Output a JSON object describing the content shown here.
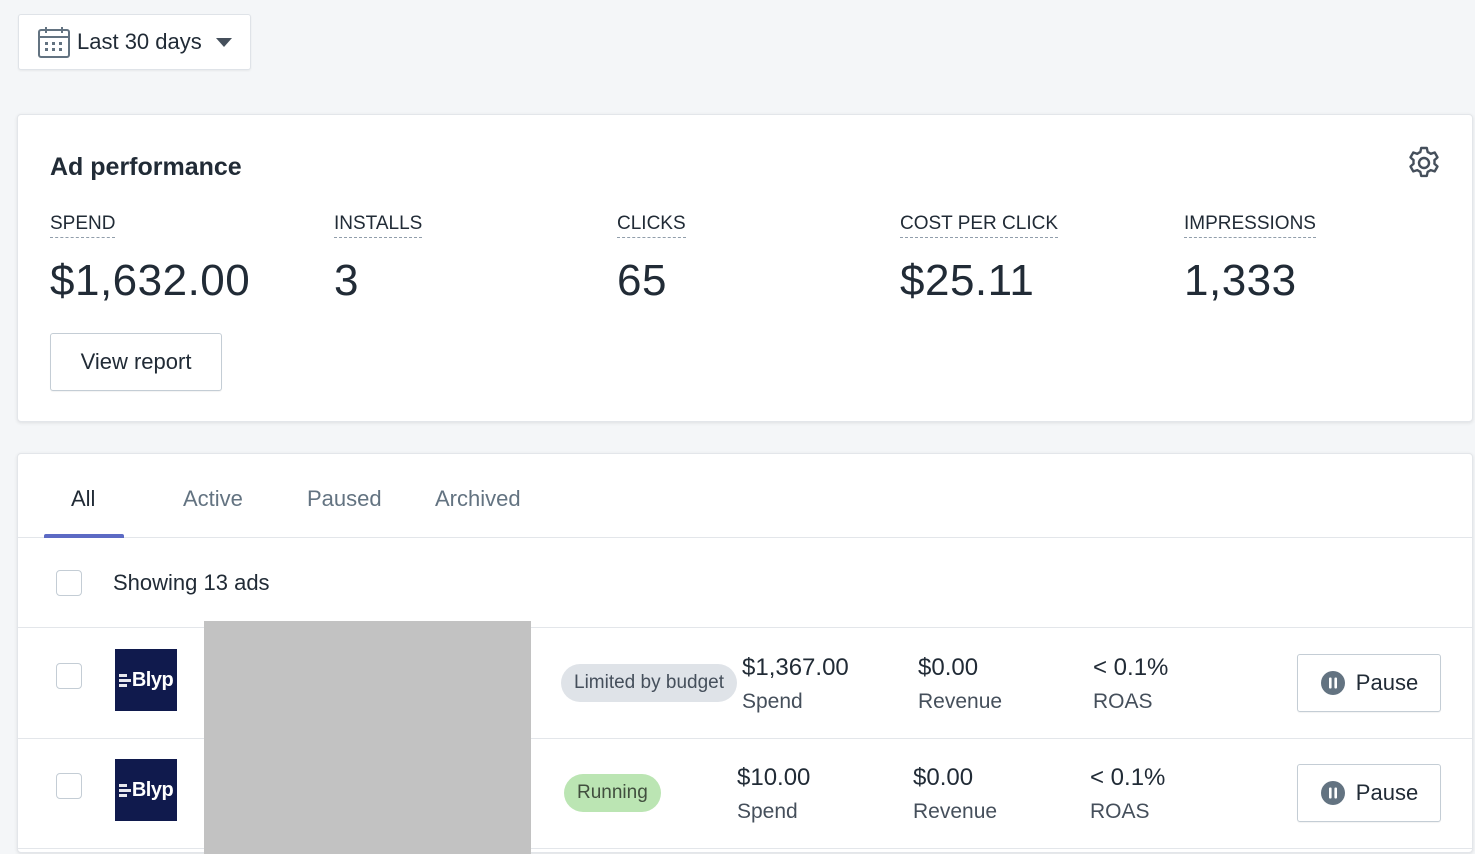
{
  "date_range": {
    "label": "Last 30 days"
  },
  "performance": {
    "title": "Ad performance",
    "metrics": [
      {
        "label": "SPEND",
        "value": "$1,632.00"
      },
      {
        "label": "INSTALLS",
        "value": "3"
      },
      {
        "label": "CLICKS",
        "value": "65"
      },
      {
        "label": "COST PER CLICK",
        "value": "$25.11"
      },
      {
        "label": "IMPRESSIONS",
        "value": "1,333"
      }
    ],
    "view_report_label": "View report"
  },
  "tabs": [
    {
      "label": "All",
      "active": true
    },
    {
      "label": "Active",
      "active": false
    },
    {
      "label": "Paused",
      "active": false
    },
    {
      "label": "Archived",
      "active": false
    }
  ],
  "list": {
    "showing_label": "Showing 13 ads",
    "rows": [
      {
        "brand": "Blyp",
        "status": "Limited by budget",
        "spend": "$1,367.00",
        "spend_label": "Spend",
        "revenue": "$0.00",
        "revenue_label": "Revenue",
        "roas": "< 0.1%",
        "roas_label": "ROAS",
        "action": "Pause"
      },
      {
        "brand": "Blyp",
        "status": "Running",
        "spend": "$10.00",
        "spend_label": "Spend",
        "revenue": "$0.00",
        "revenue_label": "Revenue",
        "roas": "< 0.1%",
        "roas_label": "ROAS",
        "action": "Pause"
      }
    ]
  },
  "icons": {
    "calendar": "calendar-icon",
    "caret": "caret-down-icon",
    "settings": "gear-icon",
    "pause": "pause-circle-icon"
  },
  "colors": {
    "tab_accent": "#5c6ac4",
    "running_badge": "#bbe5b3",
    "limited_badge": "#dfe3e8",
    "brand_logo_bg": "#101a4d"
  }
}
